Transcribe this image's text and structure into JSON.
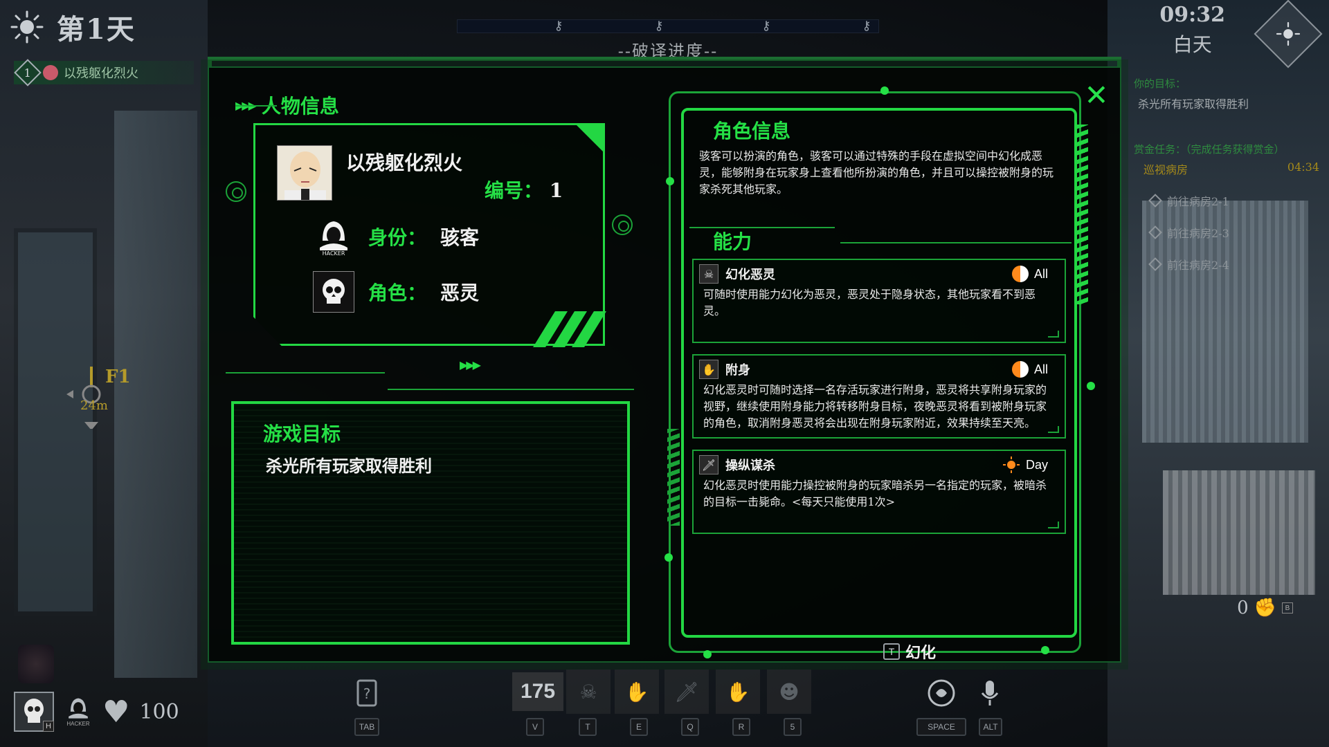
{
  "hud": {
    "day_label": "第1天",
    "player_number": "1",
    "player_name": "以残躯化烈火",
    "progress_label": "--破译进度--",
    "clock_time": "09:32",
    "clock_period": "白天",
    "floor": "F1",
    "distance": "24m",
    "health": "100",
    "ammo": "175",
    "coins": "0",
    "coins_key": "B"
  },
  "tasks": {
    "goal_title": "你的目标：",
    "goal_text": "杀光所有玩家取得胜利",
    "bounty_title": "赏金任务：（完成任务获得赏金）",
    "patrol_label": "巡视病房",
    "patrol_time": "04:34",
    "items": [
      "前往病房2-1",
      "前往病房2-3",
      "前往病房2-4"
    ]
  },
  "panel": {
    "close_label": "✕",
    "character_section_title": "人物信息",
    "character_name": "以残躯化烈火",
    "number_label": "编号：",
    "number_value": "1",
    "identity_label": "身份：",
    "identity_value": "骇客",
    "role_label": "角色：",
    "role_value": "恶灵",
    "hacker_icon_text": "HACKER",
    "goal_section_title": "游戏目标",
    "goal_text": "杀光所有玩家取得胜利",
    "role_section_title": "角色信息",
    "role_description": "骇客可以扮演的角色，骇客可以通过特殊的手段在虚拟空间中幻化成恶灵，能够附身在玩家身上查看他所扮演的角色，并且可以操控被附身的玩家杀死其他玩家。",
    "ability_section_title": "能力",
    "abilities": [
      {
        "name": "幻化恶灵",
        "tag": "All",
        "desc": "可随时使用能力幻化为恶灵，恶灵处于隐身状态，其他玩家看不到恶灵。"
      },
      {
        "name": "附身",
        "tag": "All",
        "desc": "幻化恶灵时可随时选择一名存活玩家进行附身，恶灵将共享附身玩家的视野，继续使用附身能力将转移附身目标，夜晚恶灵将看到被附身玩家的角色，取消附身恶灵将会出现在附身玩家附近，效果持续至天亮。"
      },
      {
        "name": "操纵谋杀",
        "tag": "Day",
        "desc": "幻化恶灵时使用能力操控被附身的玩家暗杀另一名指定的玩家，被暗杀的目标一击毙命。<每天只能使用1次>"
      }
    ],
    "transform_key": "T",
    "transform_label": "幻化"
  },
  "hotkeys": {
    "tab": "TAB",
    "v": "V",
    "t": "T",
    "e": "E",
    "q": "Q",
    "r": "R",
    "five": "5",
    "space": "SPACE",
    "alt": "ALT",
    "hud_h": "H",
    "hud_hacker": "HACKER"
  },
  "colors": {
    "accent": "#25e046",
    "frame": "#1ba338",
    "panel_bg": "#030604"
  }
}
